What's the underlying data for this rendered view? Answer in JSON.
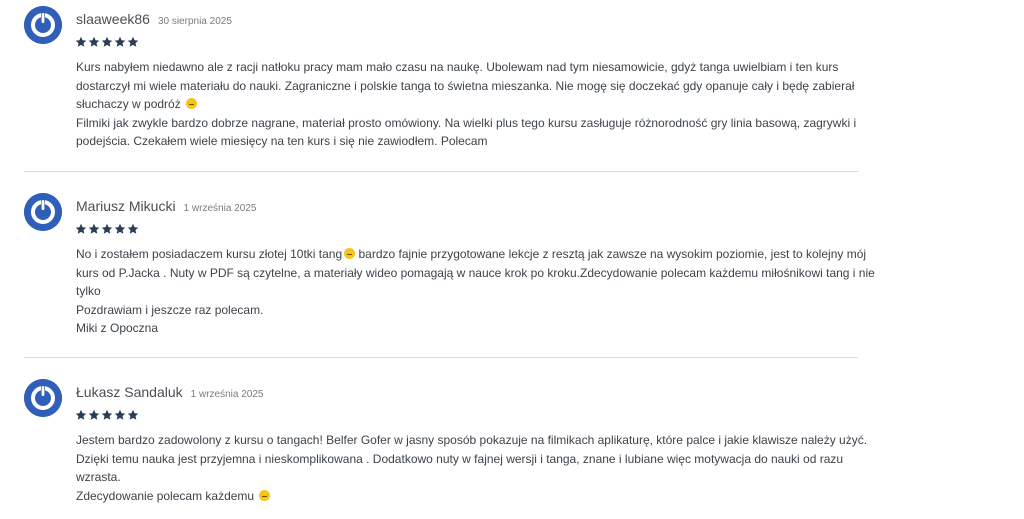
{
  "reviews": [
    {
      "author": "slaaweek86",
      "date": "30 sierpnia 2025",
      "rating": 5,
      "lines": [
        "Kurs nabyłem niedawno ale z racji natłoku pracy mam mało czasu na naukę. Ubolewam nad tym niesamowicie, gdyż tanga uwielbiam i ten kurs",
        "dostarczył mi wiele materiału do nauki. Zagraniczne i polskie tanga to świetna mieszanka. Nie mogę się doczekać gdy opanuje cały i będę zabierał",
        "słuchaczy w podróż",
        "Filmiki jak zwykle bardzo dobrze nagrane, materiał prosto omówiony. Na wielki plus tego kursu zasługuje różnorodność gry linia basową, zagrywki i",
        "podejścia. Czekałem wiele miesięcy na ten kurs i się nie zawiodłem. Polecam"
      ]
    },
    {
      "author": "Mariusz Mikucki",
      "date": "1 września 2025",
      "rating": 5,
      "lines": [
        "No i zostałem posiadaczem kursu złotej 10tki tang",
        "kurs od P.Jacka . Nuty w PDF są czytelne, a materiały wideo pomagają w nauce krok po kroku.Zdecydowanie polecam każdemu miłośnikowi tang i nie",
        "tylko",
        "Pozdrawiam i jeszcze raz polecam.",
        "Miki z Opoczna"
      ],
      "line0_after_emoji": " bardzo fajnie przygotowane lekcje z resztą jak zawsze na wysokim poziomie, jest to kolejny mój"
    },
    {
      "author": "Łukasz Sandaluk",
      "date": "1 września 2025",
      "rating": 5,
      "lines": [
        "Jestem bardzo zadowolony z kursu o tangach! Belfer Gofer w jasny sposób pokazuje na filmikach aplikaturę, które palce i jakie klawisze należy użyć.",
        "Dzięki temu nauka jest przyjemna i nieskomplikowana . Dodatkowo nuty w fajnej wersji i tanga, znane i lubiane więc motywacja do nauki od razu",
        "wzrasta.",
        "Zdecydowanie polecam każdemu"
      ]
    }
  ],
  "colors": {
    "avatar": "#2f5fb8",
    "star": "#2c3e57",
    "divider": "#dcdcde",
    "emoji": "#f5c518"
  },
  "icons": {
    "avatar": "power-avatar-icon",
    "star": "star-icon",
    "emoji": "smile-emoji-icon"
  }
}
